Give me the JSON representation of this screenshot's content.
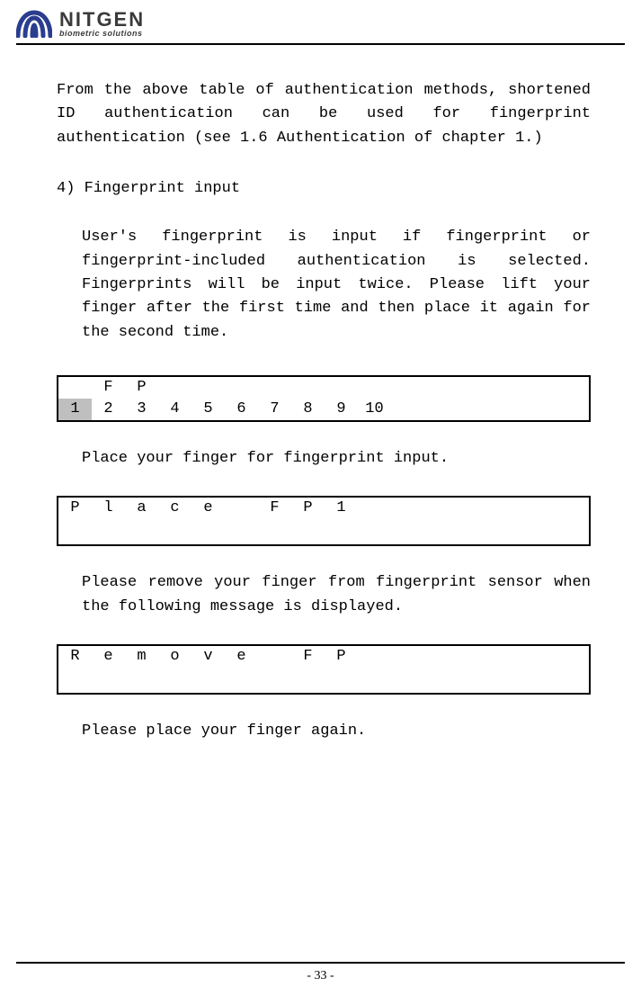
{
  "logo": {
    "name": "NITGEN",
    "tagline": "biometric solutions"
  },
  "body": {
    "para1": "From the above table of authentication methods, shortened ID authentication can be used for fingerprint authentication (see 1.6 Authentication of chapter 1.)",
    "heading4": "4) Fingerprint input",
    "para2": "User's fingerprint is input if fingerprint or fingerprint-included authentication is selected. Fingerprints will be input twice. Please lift your finger after the first time and then place it again for the second time.",
    "display1": {
      "row1": [
        "",
        "F",
        "P",
        "",
        "",
        "",
        "",
        "",
        "",
        "",
        "",
        "",
        "",
        "",
        "",
        ""
      ],
      "row2": [
        "1",
        "2",
        "3",
        "4",
        "5",
        "6",
        "7",
        "8",
        "9",
        "10",
        "",
        "",
        "",
        "",
        "",
        ""
      ]
    },
    "para3": "Place your finger for fingerprint input.",
    "display2": {
      "row1": [
        "P",
        "l",
        "a",
        "c",
        "e",
        "",
        "F",
        "P",
        "1",
        "",
        "",
        "",
        "",
        "",
        "",
        ""
      ]
    },
    "para4": "Please remove your finger from fingerprint sensor when the following message is displayed.",
    "display3": {
      "row1": [
        "R",
        "e",
        "m",
        "o",
        "v",
        "e",
        "",
        "F",
        "P",
        "",
        "",
        "",
        "",
        "",
        "",
        ""
      ]
    },
    "para5": "Please place your finger again."
  },
  "footer": {
    "page": "- 33 -"
  }
}
